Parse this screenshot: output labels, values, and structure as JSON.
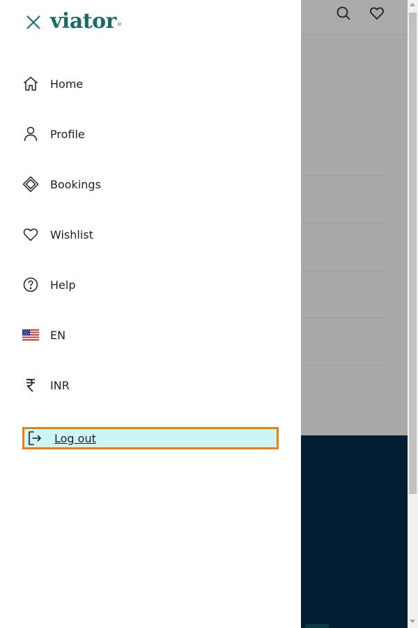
{
  "drawer": {
    "logo_text": "viator",
    "logo_tm": "®",
    "items": [
      {
        "label": "Home",
        "icon": "home-icon"
      },
      {
        "label": "Profile",
        "icon": "person-icon"
      },
      {
        "label": "Bookings",
        "icon": "ticket-icon"
      },
      {
        "label": "Wishlist",
        "icon": "heart-icon"
      },
      {
        "label": "Help",
        "icon": "help-circle-icon"
      },
      {
        "label": "EN",
        "icon": "us-flag-icon"
      },
      {
        "label": "INR",
        "icon": "rupee-icon"
      }
    ],
    "logout_label": "Log out",
    "logout_icon": "logout-icon"
  },
  "colors": {
    "brand": "#1a6b66",
    "focus_outline": "#f07e12",
    "focus_fill": "#ccf5f7",
    "overlay": "#a9a9a9",
    "footer": "#011e33"
  }
}
